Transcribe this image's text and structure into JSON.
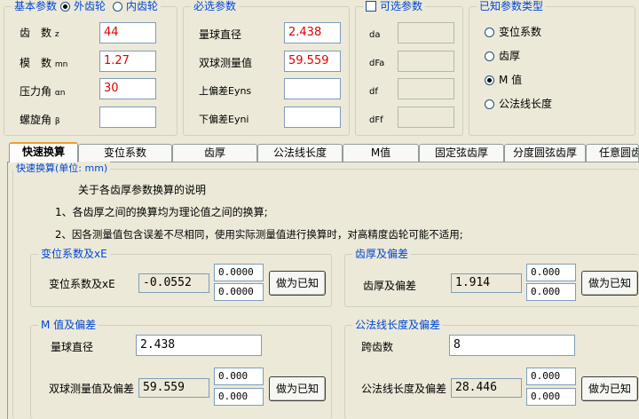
{
  "basic": {
    "title": "基本参数",
    "radio_external": "外齿轮",
    "radio_internal": "内齿轮",
    "teeth_label": "齿　数",
    "teeth_sub": "z",
    "teeth_value": "44",
    "module_label": "模　数",
    "module_sub": "mn",
    "module_value": "1.27",
    "pressure_label": "压力角",
    "pressure_sub": "αn",
    "pressure_value": "30",
    "helix_label": "螺旋角",
    "helix_sub": "β",
    "helix_value": ""
  },
  "required": {
    "title": "必选参数",
    "ball_label": "量球直径",
    "ball_value": "2.438",
    "double_ball_label": "双球测量值",
    "double_ball_value": "59.559",
    "upper_label": "上偏差Eyns",
    "upper_value": "",
    "lower_label": "下偏差Eyni",
    "lower_value": ""
  },
  "optional": {
    "title": "可选参数",
    "da": "da",
    "dFa": "dFa",
    "df": "df",
    "dFf": "dFf"
  },
  "known": {
    "title": "已知参数类型",
    "options": [
      "变位系数",
      "齿厚",
      "M 值",
      "公法线长度"
    ]
  },
  "tabs": [
    "快速换算",
    "变位系数",
    "齿厚",
    "公法线长度",
    "M值",
    "固定弦齿厚",
    "分度圆弦齿厚",
    "任意圆齿厚"
  ],
  "quick": {
    "title": "快速换算(单位: mm)",
    "note_title": "关于各齿厚参数换算的说明",
    "note1": "1、各齿厚之间的换算均为理论值之间的换算;",
    "note2": "2、因各测量值包含误差不尽相同，使用实际测量值进行换算时，对高精度齿轮可能不适用;"
  },
  "shift": {
    "title": "变位系数及xE",
    "label": "变位系数及xE",
    "value": "-0.0552",
    "dev_upper": "0.0000",
    "dev_lower": "0.0000",
    "button": "做为已知"
  },
  "thickness": {
    "title": "齿厚及偏差",
    "label": "齿厚及偏差",
    "value": "1.914",
    "dev_upper": "0.000",
    "dev_lower": "0.000",
    "button": "做为已知"
  },
  "mvalue": {
    "title": "M 值及偏差",
    "ball_label": "量球直径",
    "ball_value": "2.438",
    "label": "双球测量值及偏差",
    "value": "59.559",
    "dev_upper": "0.000",
    "dev_lower": "0.000",
    "button": "做为已知"
  },
  "span": {
    "title": "公法线长度及偏差",
    "teeth_label": "跨齿数",
    "teeth_value": "8",
    "label": "公法线长度及偏差",
    "value": "28.446",
    "dev_upper": "0.000",
    "dev_lower": "0.000",
    "button": "做为已知"
  }
}
